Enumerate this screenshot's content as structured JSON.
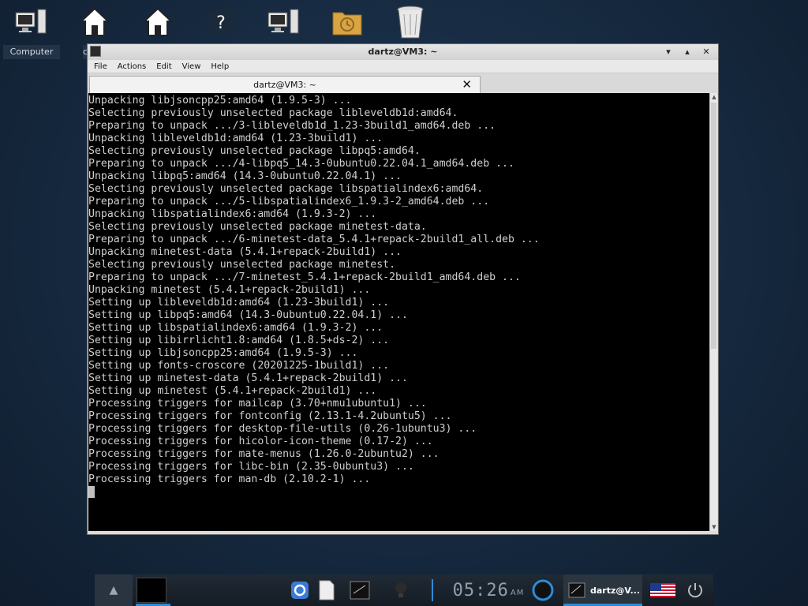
{
  "desktop": {
    "icons": [
      {
        "name": "computer-icon"
      },
      {
        "name": "home-icon"
      },
      {
        "name": "home-icon"
      },
      {
        "name": "help-icon"
      },
      {
        "name": "computer-icon"
      },
      {
        "name": "clock-folder-icon"
      },
      {
        "name": "trash-icon"
      }
    ],
    "label_computer": "Computer",
    "label_partial": "c"
  },
  "window": {
    "title": "dartz@VM3: ~",
    "menu": [
      "File",
      "Actions",
      "Edit",
      "View",
      "Help"
    ],
    "tab_label": "dartz@VM3: ~",
    "buttons": {
      "menu": "▾",
      "minimize": "▴",
      "close": "✕"
    }
  },
  "terminal": {
    "lines": [
      "Unpacking libjsoncpp25:amd64 (1.9.5-3) ...",
      "Selecting previously unselected package libleveldb1d:amd64.",
      "Preparing to unpack .../3-libleveldb1d_1.23-3build1_amd64.deb ...",
      "Unpacking libleveldb1d:amd64 (1.23-3build1) ...",
      "Selecting previously unselected package libpq5:amd64.",
      "Preparing to unpack .../4-libpq5_14.3-0ubuntu0.22.04.1_amd64.deb ...",
      "Unpacking libpq5:amd64 (14.3-0ubuntu0.22.04.1) ...",
      "Selecting previously unselected package libspatialindex6:amd64.",
      "Preparing to unpack .../5-libspatialindex6_1.9.3-2_amd64.deb ...",
      "Unpacking libspatialindex6:amd64 (1.9.3-2) ...",
      "Selecting previously unselected package minetest-data.",
      "Preparing to unpack .../6-minetest-data_5.4.1+repack-2build1_all.deb ...",
      "Unpacking minetest-data (5.4.1+repack-2build1) ...",
      "Selecting previously unselected package minetest.",
      "Preparing to unpack .../7-minetest_5.4.1+repack-2build1_amd64.deb ...",
      "Unpacking minetest (5.4.1+repack-2build1) ...",
      "Setting up libleveldb1d:amd64 (1.23-3build1) ...",
      "Setting up libpq5:amd64 (14.3-0ubuntu0.22.04.1) ...",
      "Setting up libspatialindex6:amd64 (1.9.3-2) ...",
      "Setting up libirrlicht1.8:amd64 (1.8.5+ds-2) ...",
      "Setting up libjsoncpp25:amd64 (1.9.5-3) ...",
      "Setting up fonts-croscore (20201225-1build1) ...",
      "Setting up minetest-data (5.4.1+repack-2build1) ...",
      "Setting up minetest (5.4.1+repack-2build1) ...",
      "Processing triggers for mailcap (3.70+nmu1ubuntu1) ...",
      "Processing triggers for fontconfig (2.13.1-4.2ubuntu5) ...",
      "Processing triggers for desktop-file-utils (0.26-1ubuntu3) ...",
      "Processing triggers for hicolor-icon-theme (0.17-2) ...",
      "Processing triggers for mate-menus (1.26.0-2ubuntu2) ...",
      "Processing triggers for libc-bin (2.35-0ubuntu3) ...",
      "Processing triggers for man-db (2.10.2-1) ..."
    ]
  },
  "taskbar": {
    "clock": "05:26",
    "ampm": "AM",
    "task_label": "dartz@V...",
    "up_arrow": "▲",
    "accent": "#2e8bd6"
  }
}
